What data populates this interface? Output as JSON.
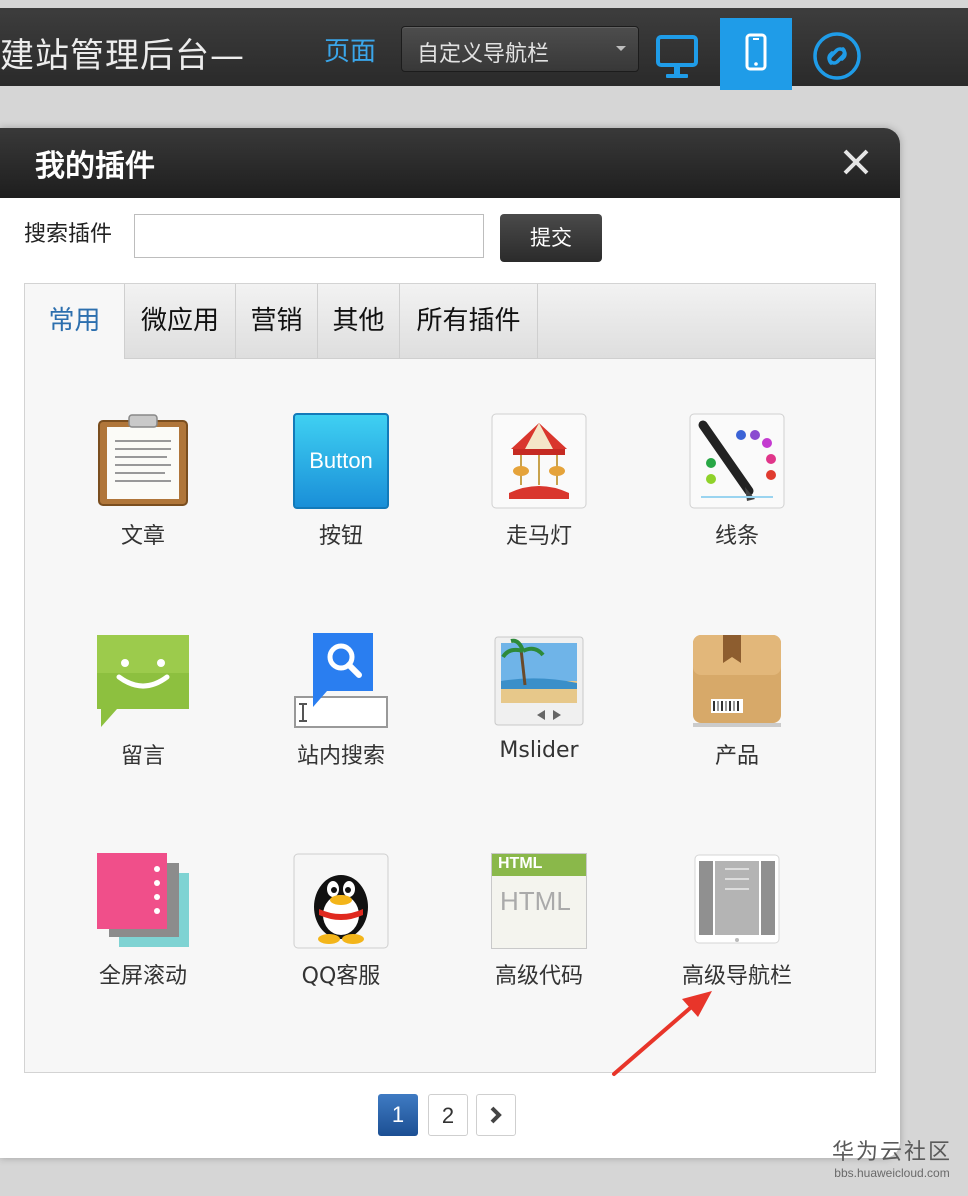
{
  "topbar": {
    "app_title": "建站管理后台—",
    "page_label": "页面",
    "nav_select_value": "自定义导航栏",
    "accent_color": "#1f9ce8",
    "tools": [
      {
        "name": "desktop-preview",
        "icon": "monitor-icon"
      },
      {
        "name": "mobile-preview",
        "icon": "mobile-icon",
        "active": true
      },
      {
        "name": "link",
        "icon": "link-icon"
      }
    ]
  },
  "modal": {
    "title": "我的插件",
    "search_label": "搜索插件",
    "search_value": "",
    "submit_label": "提交",
    "tabs": [
      {
        "label": "常用",
        "active": true
      },
      {
        "label": "微应用"
      },
      {
        "label": "营销"
      },
      {
        "label": "其他"
      },
      {
        "label": "所有插件"
      }
    ],
    "plugins": [
      {
        "label": "文章",
        "icon": "clipboard-icon"
      },
      {
        "label": "按钮",
        "icon": "button-icon",
        "icon_text": "Button"
      },
      {
        "label": "走马灯",
        "icon": "carousel-icon"
      },
      {
        "label": "线条",
        "icon": "pen-icon"
      },
      {
        "label": "留言",
        "icon": "message-icon"
      },
      {
        "label": "站内搜索",
        "icon": "search-icon"
      },
      {
        "label": "Mslider",
        "icon": "slider-icon"
      },
      {
        "label": "产品",
        "icon": "product-box-icon"
      },
      {
        "label": "全屏滚动",
        "icon": "fullscreen-scroll-icon"
      },
      {
        "label": "QQ客服",
        "icon": "qq-penguin-icon"
      },
      {
        "label": "高级代码",
        "icon": "html-code-icon",
        "icon_text": "HTML"
      },
      {
        "label": "高级导航栏",
        "icon": "advanced-nav-icon"
      }
    ],
    "pagination": {
      "pages": [
        "1",
        "2"
      ],
      "current": "1",
      "next_icon": "chevron-right-icon"
    }
  },
  "watermark": {
    "main": "华为云社区",
    "sub": "bbs.huaweicloud.com"
  }
}
